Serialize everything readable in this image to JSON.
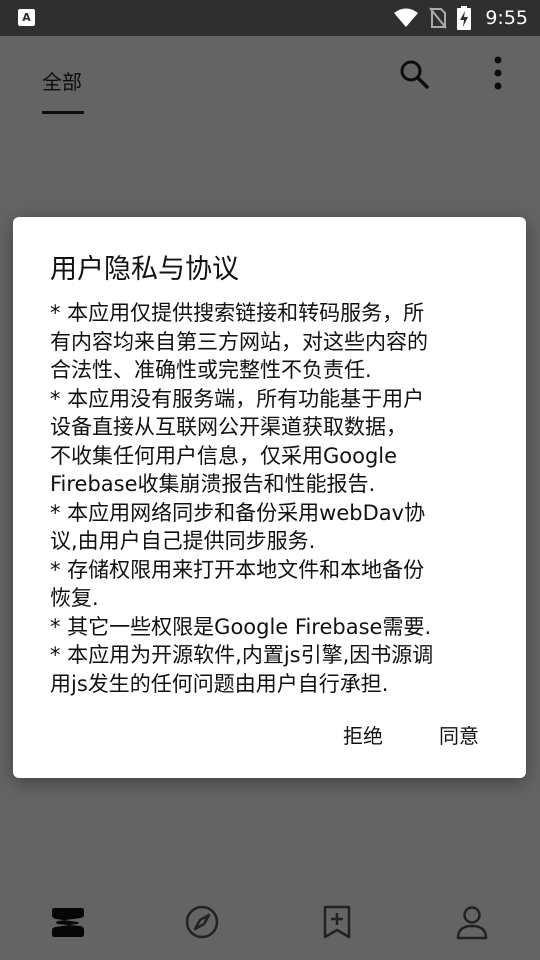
{
  "status_bar": {
    "app_icon": "A",
    "time": "9:55",
    "icons": [
      "wifi-icon",
      "no-sim-icon",
      "battery-charging-icon"
    ]
  },
  "header": {
    "tab_all": "全部",
    "search_icon": "search-icon",
    "more_icon": "more-vert-icon"
  },
  "dialog": {
    "title": "用户隐私与协议",
    "body": "* 本应用仅提供搜索链接和转码服务，所\n有内容均来自第三方网站，对这些内容的\n合法性、准确性或完整性不负责任.\n* 本应用没有服务端，所有功能基于用户\n设备直接从互联网公开渠道获取数据，\n不收集任何用户信息，仅采用Google\nFirebase收集崩溃报告和性能报告.\n* 本应用网络同步和备份采用webDav协\n议,由用户自己提供同步服务.\n* 存储权限用来打开本地文件和本地备份\n恢复.\n* 其它一些权限是Google Firebase需要.\n* 本应用为开源软件,内置js引擎,因书源调\n用js发生的任何问题由用户自行承担.",
    "reject_label": "拒绝",
    "agree_label": "同意"
  },
  "bottom_nav": {
    "items": [
      "bookshelf-icon",
      "explore-icon",
      "rss-bookmark-icon",
      "profile-icon"
    ]
  }
}
